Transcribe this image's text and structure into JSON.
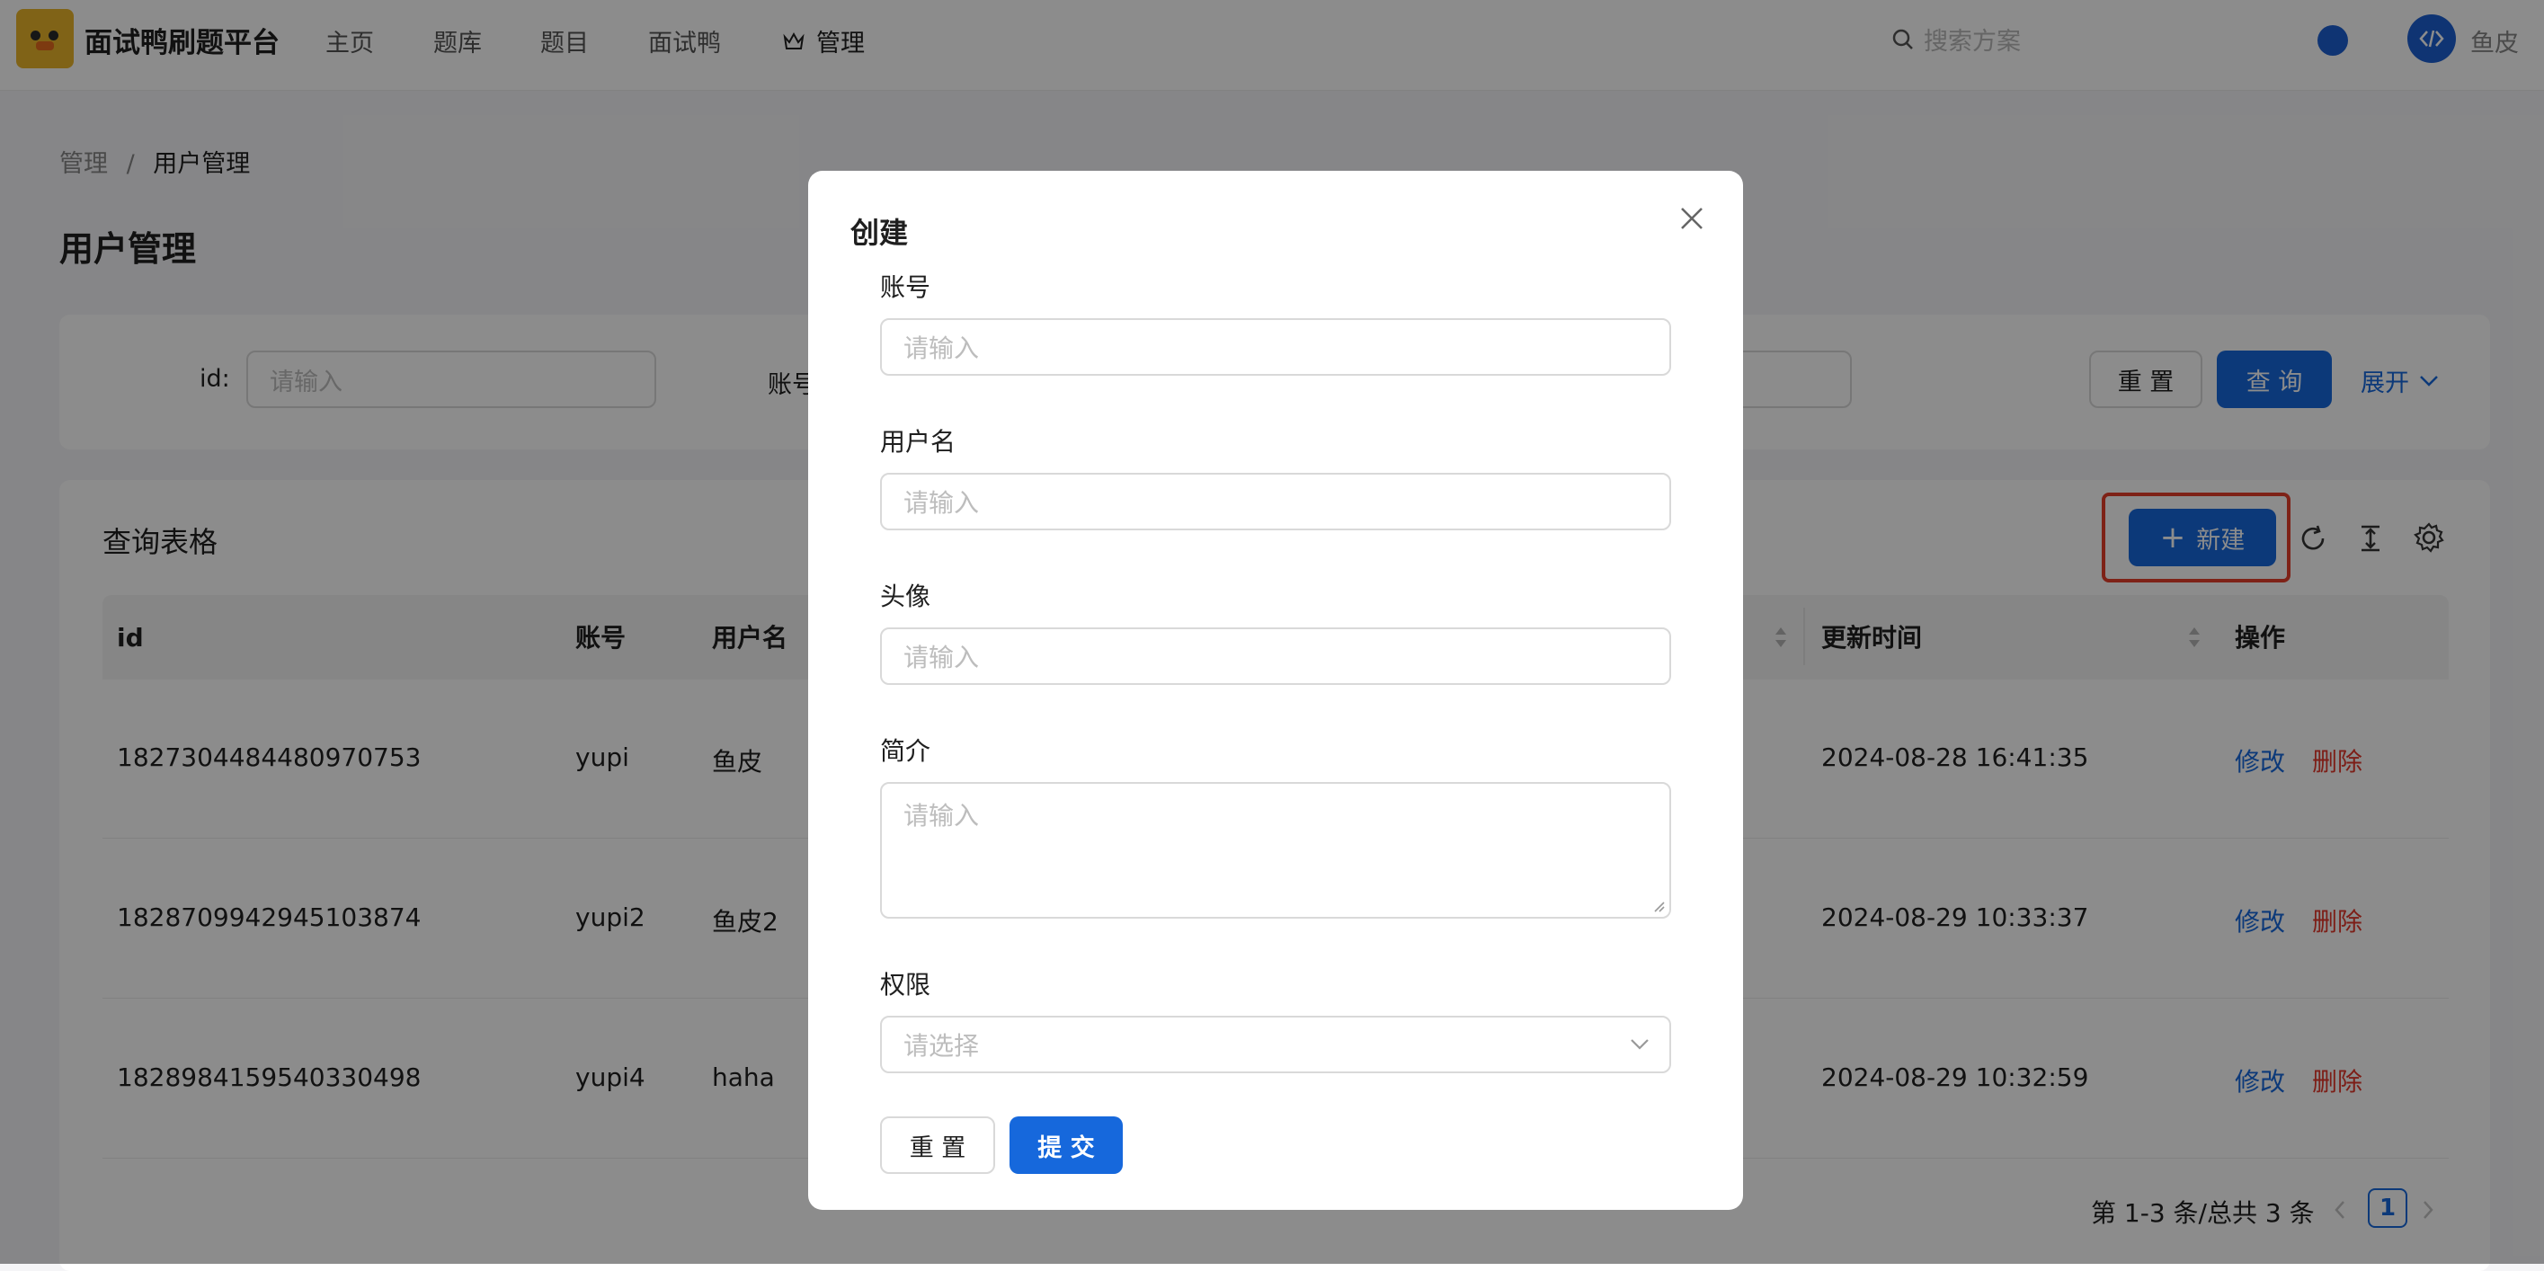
{
  "header": {
    "app_title": "面试鸭刷题平台",
    "nav": [
      "主页",
      "题库",
      "题目",
      "面试鸭"
    ],
    "admin_label": "管理",
    "search_placeholder": "搜索方案",
    "user_name": "鱼皮",
    "avatar_icon": "code-icon",
    "accent_color": "#1d5fd1"
  },
  "breadcrumb": {
    "parent": "管理",
    "separator": "/",
    "current": "用户管理"
  },
  "page_title": "用户管理",
  "search_form": {
    "id_label": "id:",
    "id_placeholder": "请输入",
    "account_label": "账号",
    "reset_label": "重 置",
    "query_label": "查 询",
    "expand_label": "展开"
  },
  "table": {
    "title": "查询表格",
    "new_label": "新建",
    "columns": {
      "id": "id",
      "account": "账号",
      "username": "用户名",
      "update_time": "更新时间",
      "actions": "操作"
    },
    "rows": [
      {
        "id": "1827304484480970753",
        "account": "yupi",
        "username": "鱼皮",
        "update_time": "2024-08-28 16:41:35",
        "edit": "修改",
        "delete": "删除"
      },
      {
        "id": "1828709942945103874",
        "account": "yupi2",
        "username": "鱼皮2",
        "update_time": "2024-08-29 10:33:37",
        "edit": "修改",
        "delete": "删除"
      },
      {
        "id": "1828984159540330498",
        "account": "yupi4",
        "username": "haha",
        "update_time": "2024-08-29 10:32:59",
        "edit": "修改",
        "delete": "删除"
      }
    ],
    "pagination": {
      "summary": "第 1-3 条/总共 3 条",
      "current_page": "1"
    }
  },
  "modal": {
    "title": "创建",
    "fields": {
      "account_label": "账号",
      "account_placeholder": "请输入",
      "username_label": "用户名",
      "username_placeholder": "请输入",
      "avatar_label": "头像",
      "avatar_placeholder": "请输入",
      "profile_label": "简介",
      "profile_placeholder": "请输入",
      "role_label": "权限",
      "role_placeholder": "请选择"
    },
    "reset_label": "重 置",
    "submit_label": "提 交"
  }
}
